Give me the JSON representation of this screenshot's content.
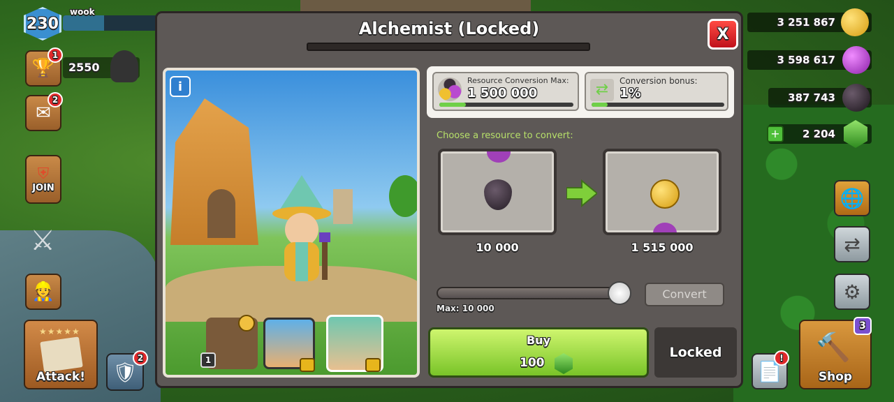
{
  "player": {
    "level": "230",
    "name": "wook",
    "xp_progress": 0.42,
    "trophies": "2550",
    "trophy_badge": "1",
    "mail_badge": "2",
    "clan_label": "JOIN"
  },
  "resources": {
    "gold": "3 251 867",
    "elixir": "3 598 617",
    "dark_elixir": "387 743",
    "gems": "2 204"
  },
  "left_buttons": {
    "attack_label": "Attack!",
    "shield_badge": "2"
  },
  "right_buttons": {
    "shop_label": "Shop",
    "shop_badge": "3",
    "notes_badge": "!"
  },
  "dialog": {
    "title": "Alchemist (Locked)",
    "close_glyph": "X",
    "info_glyph": "i",
    "hero_portrait_badge": "1",
    "max_conversion": {
      "label": "Resource Conversion Max:",
      "value": "1 500 000",
      "progress": 0.2
    },
    "bonus": {
      "label": "Conversion bonus:",
      "value": "1%",
      "progress": 0.12
    },
    "choose_label": "Choose a resource to convert:",
    "from_amount": "10 000",
    "to_amount": "1 515 000",
    "slider_max_label": "Max: 10  000",
    "slider_value": 1.0,
    "convert_label": "Convert",
    "buy_label": "Buy",
    "buy_price": "100",
    "locked_label": "Locked"
  },
  "icons": {
    "level": "level-badge-icon",
    "trophy": "trophy-icon",
    "mail": "mail-icon",
    "clan": "clan-shield-icon",
    "crossed_swords": "crossed-swords-icon",
    "gold": "gold-coin-icon",
    "elixir": "elixir-drop-icon",
    "dark_elixir": "dark-elixir-drop-icon",
    "gem": "gem-icon",
    "settings": "gear-icon",
    "close": "close-icon",
    "info": "info-icon",
    "lock": "lock-icon"
  },
  "colors": {
    "gold": "#f0c030",
    "elixir": "#b94ad0",
    "dark_elixir": "#3a2e3a",
    "gem": "#59c43a",
    "buy_green": "#a8e04a",
    "close_red": "#e02a2a"
  }
}
